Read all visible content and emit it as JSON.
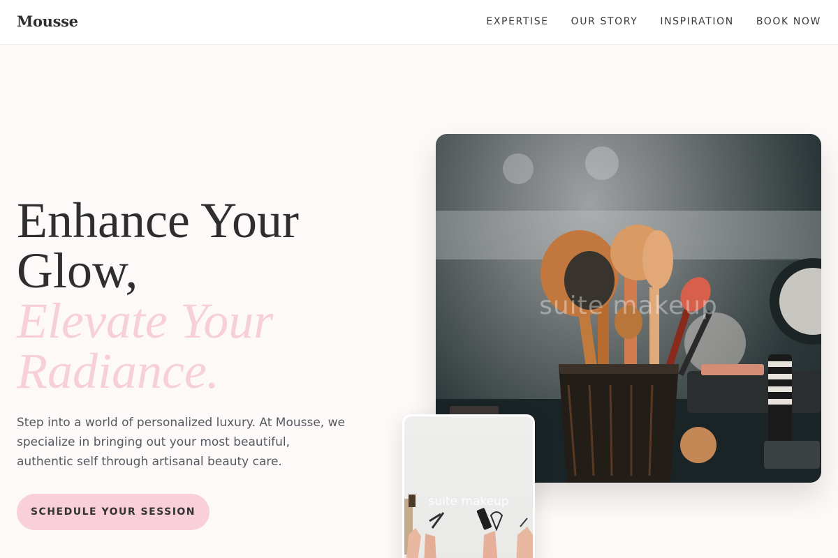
{
  "nav": {
    "brand": "Mousse",
    "links": [
      "EXPERTISE",
      "OUR STORY",
      "INSPIRATION",
      "BOOK NOW"
    ]
  },
  "hero": {
    "headline_line1": "Enhance Your",
    "headline_line2": "Glow,",
    "accent_line1": "Elevate Your",
    "accent_line2": "Radiance.",
    "description": "Step into a world of personalized luxury. At Mousse, we specialize in bringing out your most beautiful, authentic self through artisanal beauty care.",
    "cta_label": "SCHEDULE YOUR SESSION"
  },
  "images": {
    "main_overlay": "suite makeup",
    "small_overlay": "suite makeup"
  },
  "colors": {
    "accent_pink": "#f9cfd9",
    "background": "#fdf9f8",
    "text_dark": "#2e2e2e"
  }
}
